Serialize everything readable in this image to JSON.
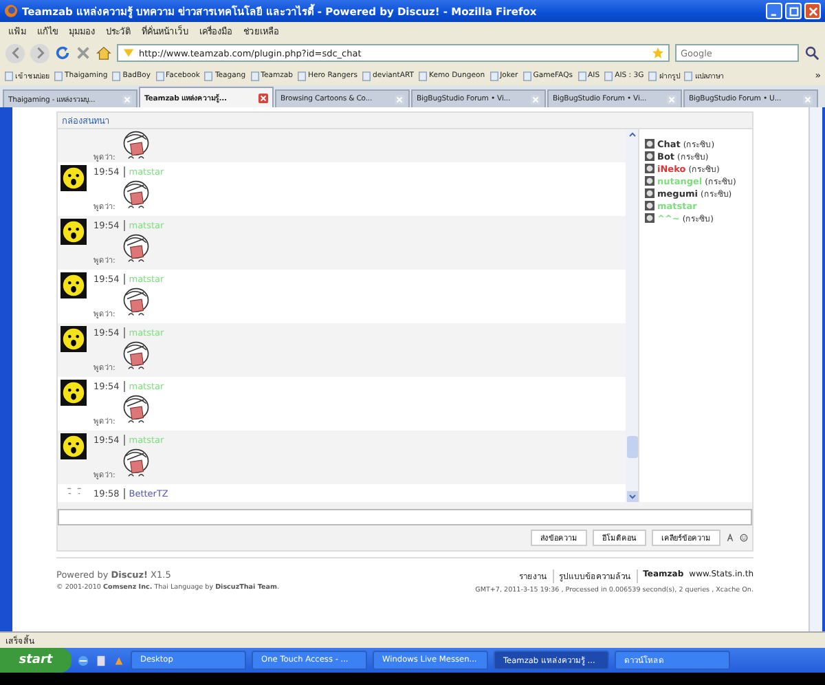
{
  "window": {
    "title": "Teamzab แหล่งความรู้ บทความ ข่าวสารเทคโนโลยี และวาไรตี้ - Powered by Discuz! - Mozilla Firefox"
  },
  "menu": [
    "แฟ้ม",
    "แก้ไข",
    "มุมมอง",
    "ประวัติ",
    "ที่คั่นหน้าเว็บ",
    "เครื่องมือ",
    "ช่วยเหลือ"
  ],
  "address_bar": {
    "url": "http://www.teamzab.com/plugin.php?id=sdc_chat"
  },
  "search": {
    "placeholder": "Google"
  },
  "bookmarks": [
    "เข้าชมบ่อย",
    "Thaigaming",
    "BadBoy",
    "Facebook",
    "Teagang",
    "Teamzab",
    "Hero Rangers",
    "deviantART",
    "Kemo Dungeon",
    "Joker",
    "GameFAQs",
    "AIS",
    "AIS : 3G",
    "ฝากรูป",
    "แปลภาษา"
  ],
  "bookmarks_more": "»",
  "tabs": [
    {
      "label": "Thaigaming - แหล่งรวมบุ...",
      "selected": false
    },
    {
      "label": "Teamzab แหล่งความรู้...",
      "selected": true
    },
    {
      "label": "Browsing Cartoons & Co...",
      "selected": false
    },
    {
      "label": "BigBugStudio Forum • Vi...",
      "selected": false
    },
    {
      "label": "BigBugStudio Forum • Vi...",
      "selected": false
    },
    {
      "label": "BigBugStudio Forum • U...",
      "selected": false
    }
  ],
  "chat": {
    "title": "กล่องสนทนา",
    "messages": [
      {
        "says": "พูดว่า:"
      },
      {
        "time": "19:54",
        "user": "matstar",
        "color": "#7fdc7f",
        "says": "พูดว่า:"
      },
      {
        "time": "19:54",
        "user": "matstar",
        "color": "#7fdc7f",
        "says": "พูดว่า:"
      },
      {
        "time": "19:54",
        "user": "matstar",
        "color": "#7fdc7f",
        "says": "พูดว่า:"
      },
      {
        "time": "19:54",
        "user": "matstar",
        "color": "#7fdc7f",
        "says": "พูดว่า:"
      },
      {
        "time": "19:54",
        "user": "matstar",
        "color": "#7fdc7f",
        "says": "พูดว่า:"
      },
      {
        "time": "19:54",
        "user": "matstar",
        "color": "#7fdc7f",
        "says": "พูดว่า:"
      },
      {
        "time": "19:58",
        "user": "BetterTZ",
        "color": "#5555bb"
      }
    ],
    "users": [
      {
        "name": "Chat",
        "color": "#333333",
        "status": "(กระซิบ)"
      },
      {
        "name": "Bot",
        "color": "#333333",
        "status": "(กระซิบ)"
      },
      {
        "name": "iNeko",
        "color": "#dd3333",
        "status": "(กระซิบ)"
      },
      {
        "name": "nutangel",
        "color": "#7fdc7f",
        "status": "(กระซิบ)"
      },
      {
        "name": "megumi",
        "color": "#333333",
        "status": "(กระซิบ)"
      },
      {
        "name": "matstar",
        "color": "#7fdc7f"
      },
      {
        "name": "^^~",
        "color": "#7fdc7f",
        "status": "(กระซิบ)"
      }
    ],
    "buttons": [
      "ส่งข้อความ",
      "อีโมติคอน",
      "เคลียร์ข้อความ"
    ]
  },
  "footer": {
    "powered": "Powered by **Discuz!** X1.5",
    "copyright": "© 2001-2010 **Comsenz Inc.** Thai Language by **DiscuzThai Team**.",
    "links": [
      "รายงาน",
      "รูปแบบข้อความล้วน"
    ],
    "site": "Teamzab",
    "stats": "www.Stats.in.th",
    "info": "GMT+7, 2011-3-15 19:36 , Processed in 0.006539 second(s), 2 queries , Xcache On."
  },
  "status_bar": "เสร็จสิ้น",
  "taskbar": {
    "start": "start",
    "items": [
      {
        "label": "Desktop",
        "selected": false
      },
      {
        "label": "One Touch Access - ...",
        "selected": false
      },
      {
        "label": "Windows Live Messen...",
        "selected": false
      },
      {
        "label": "Teamzab แหล่งความรู้ ...",
        "selected": true
      },
      {
        "label": "ดาวน์โหลด",
        "selected": false
      }
    ]
  }
}
